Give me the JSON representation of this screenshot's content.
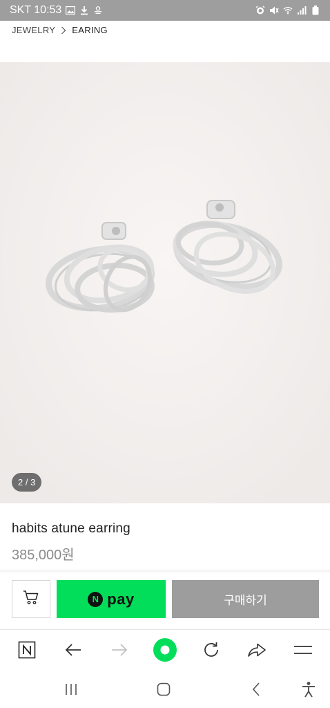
{
  "status_bar": {
    "carrier_time": "SKT 10:53",
    "left_icons": [
      "gallery-icon",
      "download-icon",
      "pay-icon"
    ],
    "right_icons": [
      "alarm-icon",
      "mute-icon",
      "wifi-icon",
      "signal-icon",
      "battery-icon"
    ]
  },
  "breadcrumb": {
    "items": [
      "JEWELRY",
      "EARING"
    ]
  },
  "product": {
    "image_counter": "2 / 3",
    "name": "habits atune earring",
    "price": "385,000원"
  },
  "actions": {
    "cart_icon": "cart-icon",
    "npay_n": "N",
    "npay_label": "pay",
    "buy_label": "구매하기"
  },
  "browser_toolbar": {
    "icons": [
      "naver-home-icon",
      "back-arrow-icon",
      "forward-arrow-icon",
      "green-dot-icon",
      "refresh-icon",
      "share-icon",
      "menu-icon"
    ]
  },
  "system_nav": {
    "icons": [
      "recent-apps-icon",
      "home-icon",
      "back-icon",
      "accessibility-icon"
    ]
  },
  "colors": {
    "status_bar": "#9e9e9e",
    "npay_green": "#03de5a",
    "buy_gray": "#9d9d9d",
    "image_bg": "#f3efee"
  }
}
